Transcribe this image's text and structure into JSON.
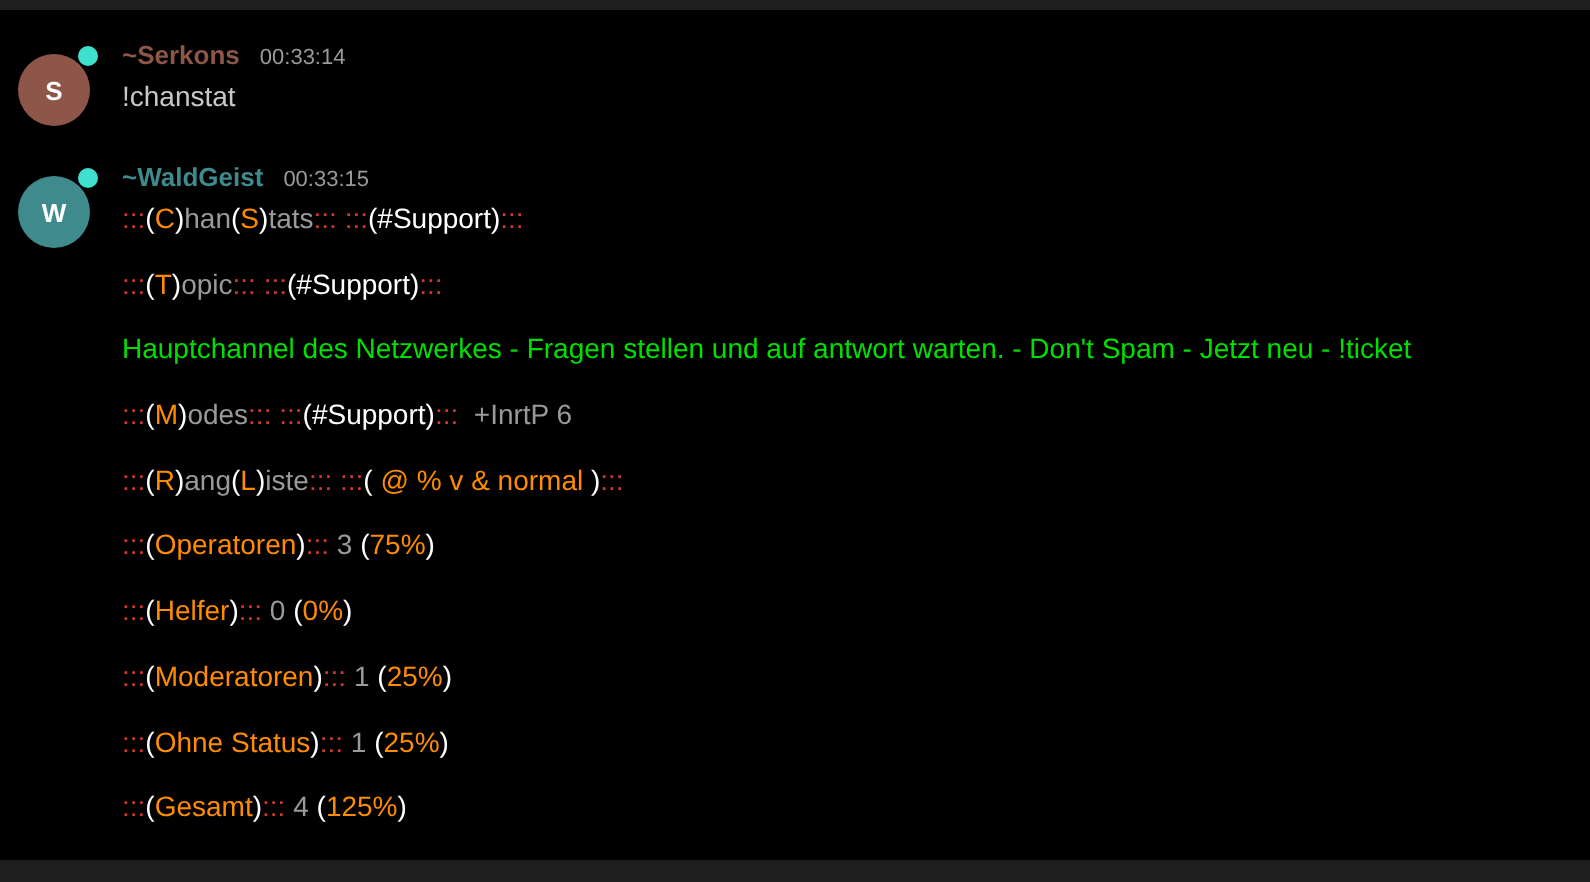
{
  "messages": [
    {
      "author": "~Serkons",
      "avatar_letter": "S",
      "color": "#8e5648",
      "online": true,
      "time": "00:33:14",
      "lines": [
        [
          {
            "text": "!chanstat",
            "color": "#c8c8c8"
          }
        ]
      ]
    },
    {
      "author": "~WaldGeist",
      "avatar_letter": "W",
      "color": "#3f8a8c",
      "online": true,
      "time": "00:33:15",
      "lines": [
        [
          {
            "text": ":::",
            "color": "#d03a2a"
          },
          {
            "text": "(",
            "color": "#ffffff"
          },
          {
            "text": "C",
            "color": "#ff8c00"
          },
          {
            "text": ")",
            "color": "#ffffff"
          },
          {
            "text": "han",
            "color": "#9a9a9a"
          },
          {
            "text": "(",
            "color": "#ffffff"
          },
          {
            "text": "S",
            "color": "#ff8c00"
          },
          {
            "text": ")",
            "color": "#ffffff"
          },
          {
            "text": "tats",
            "color": "#9a9a9a"
          },
          {
            "text": ":::",
            "color": "#d03a2a"
          },
          {
            "text": " :::",
            "color": "#d03a2a"
          },
          {
            "text": "(#Support)",
            "color": "#ffffff"
          },
          {
            "text": ":::",
            "color": "#d03a2a"
          }
        ],
        [
          {
            "text": ":::",
            "color": "#d03a2a"
          },
          {
            "text": "(",
            "color": "#ffffff"
          },
          {
            "text": "T",
            "color": "#ff8c00"
          },
          {
            "text": ")",
            "color": "#ffffff"
          },
          {
            "text": "opic",
            "color": "#9a9a9a"
          },
          {
            "text": ":::",
            "color": "#d03a2a"
          },
          {
            "text": " :::",
            "color": "#d03a2a"
          },
          {
            "text": "(#Support)",
            "color": "#ffffff"
          },
          {
            "text": ":::",
            "color": "#d03a2a"
          }
        ],
        [
          {
            "text": "Hauptchannel des Netzwerkes - Fragen stellen und auf antwort warten. - Don't Spam - Jetzt neu - !ticket",
            "color": "#00e000"
          }
        ],
        [
          {
            "text": ":::",
            "color": "#d03a2a"
          },
          {
            "text": "(",
            "color": "#ffffff"
          },
          {
            "text": "M",
            "color": "#ff8c00"
          },
          {
            "text": ")",
            "color": "#ffffff"
          },
          {
            "text": "odes",
            "color": "#9a9a9a"
          },
          {
            "text": ":::",
            "color": "#d03a2a"
          },
          {
            "text": " :::",
            "color": "#d03a2a"
          },
          {
            "text": "(#Support)",
            "color": "#ffffff"
          },
          {
            "text": ":::",
            "color": "#d03a2a"
          },
          {
            "text": "  +InrtP 6",
            "color": "#9a9a9a"
          }
        ],
        [
          {
            "text": ":::",
            "color": "#d03a2a"
          },
          {
            "text": "(",
            "color": "#ffffff"
          },
          {
            "text": "R",
            "color": "#ff8c00"
          },
          {
            "text": ")",
            "color": "#ffffff"
          },
          {
            "text": "ang",
            "color": "#9a9a9a"
          },
          {
            "text": "(",
            "color": "#ffffff"
          },
          {
            "text": "L",
            "color": "#ff8c00"
          },
          {
            "text": ")",
            "color": "#ffffff"
          },
          {
            "text": "iste",
            "color": "#9a9a9a"
          },
          {
            "text": ":::",
            "color": "#d03a2a"
          },
          {
            "text": " :::",
            "color": "#d03a2a"
          },
          {
            "text": "( ",
            "color": "#ffffff"
          },
          {
            "text": "@ % v & normal",
            "color": "#ff8c00"
          },
          {
            "text": " )",
            "color": "#ffffff"
          },
          {
            "text": ":::",
            "color": "#d03a2a"
          }
        ],
        [
          {
            "text": ":::",
            "color": "#d03a2a"
          },
          {
            "text": "(",
            "color": "#ffffff"
          },
          {
            "text": "Operatoren",
            "color": "#ff8c00"
          },
          {
            "text": ")",
            "color": "#ffffff"
          },
          {
            "text": ":::",
            "color": "#d03a2a"
          },
          {
            "text": " 3 ",
            "color": "#9a9a9a"
          },
          {
            "text": "(",
            "color": "#ffffff"
          },
          {
            "text": "75%",
            "color": "#ff8c00"
          },
          {
            "text": ")",
            "color": "#ffffff"
          }
        ],
        [
          {
            "text": ":::",
            "color": "#d03a2a"
          },
          {
            "text": "(",
            "color": "#ffffff"
          },
          {
            "text": "Helfer",
            "color": "#ff8c00"
          },
          {
            "text": ")",
            "color": "#ffffff"
          },
          {
            "text": ":::",
            "color": "#d03a2a"
          },
          {
            "text": " 0 ",
            "color": "#9a9a9a"
          },
          {
            "text": "(",
            "color": "#ffffff"
          },
          {
            "text": "0%",
            "color": "#ff8c00"
          },
          {
            "text": ")",
            "color": "#ffffff"
          }
        ],
        [
          {
            "text": ":::",
            "color": "#d03a2a"
          },
          {
            "text": "(",
            "color": "#ffffff"
          },
          {
            "text": "Moderatoren",
            "color": "#ff8c00"
          },
          {
            "text": ")",
            "color": "#ffffff"
          },
          {
            "text": ":::",
            "color": "#d03a2a"
          },
          {
            "text": " 1 ",
            "color": "#9a9a9a"
          },
          {
            "text": "(",
            "color": "#ffffff"
          },
          {
            "text": "25%",
            "color": "#ff8c00"
          },
          {
            "text": ")",
            "color": "#ffffff"
          }
        ],
        [
          {
            "text": ":::",
            "color": "#d03a2a"
          },
          {
            "text": "(",
            "color": "#ffffff"
          },
          {
            "text": "Ohne Status",
            "color": "#ff8c00"
          },
          {
            "text": ")",
            "color": "#ffffff"
          },
          {
            "text": ":::",
            "color": "#d03a2a"
          },
          {
            "text": " 1 ",
            "color": "#9a9a9a"
          },
          {
            "text": "(",
            "color": "#ffffff"
          },
          {
            "text": "25%",
            "color": "#ff8c00"
          },
          {
            "text": ")",
            "color": "#ffffff"
          }
        ],
        [
          {
            "text": ":::",
            "color": "#d03a2a"
          },
          {
            "text": "(",
            "color": "#ffffff"
          },
          {
            "text": "Gesamt",
            "color": "#ff8c00"
          },
          {
            "text": ")",
            "color": "#ffffff"
          },
          {
            "text": ":::",
            "color": "#d03a2a"
          },
          {
            "text": " 4 ",
            "color": "#9a9a9a"
          },
          {
            "text": "(",
            "color": "#ffffff"
          },
          {
            "text": "125%",
            "color": "#ff8c00"
          },
          {
            "text": ")",
            "color": "#ffffff"
          }
        ]
      ]
    }
  ]
}
